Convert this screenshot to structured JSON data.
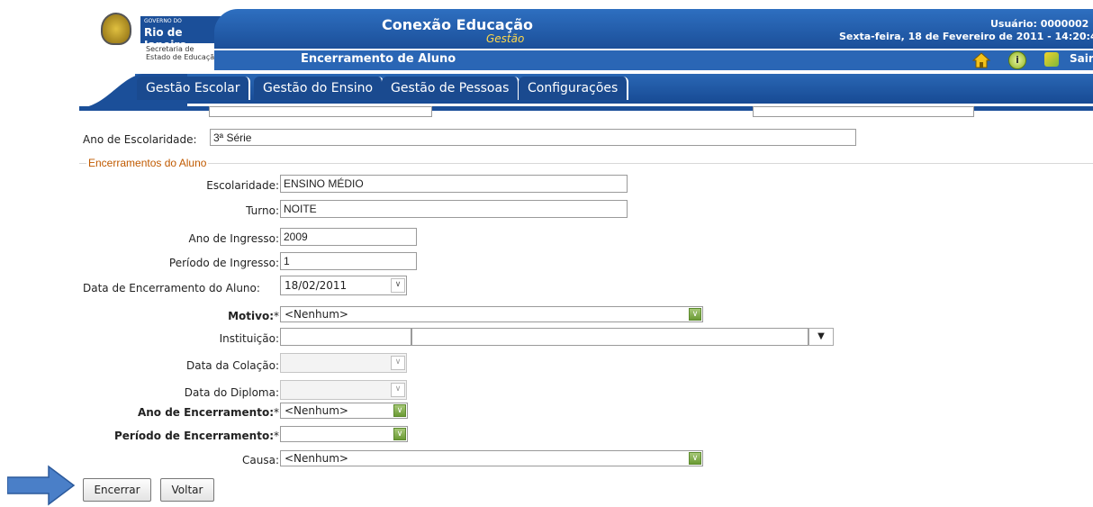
{
  "header": {
    "logo_small": "GOVERNO DO",
    "logo_state": "Rio de Janeiro",
    "logo_dept_line1": "Secretaria de",
    "logo_dept_line2": "Estado de Educação",
    "app_title": "Conexão Educação",
    "app_subtitle": "Gestão",
    "page_title": "Encerramento de Aluno",
    "user_label": "Usuário: 0000002",
    "date_line": "Sexta-feira, 18 de Fevereiro de 2011 - 14:20:4",
    "exit_label": "Sair"
  },
  "nav": {
    "tabs": [
      "Gestão Escolar",
      "Gestão do Ensino",
      "Gestão de Pessoas",
      "Configurações"
    ]
  },
  "form": {
    "ano_escolaridade_label": "Ano de Escolaridade:",
    "ano_escolaridade_value": "3ª Série",
    "fieldset_legend": "Encerramentos do Aluno",
    "escolaridade_label": "Escolaridade:",
    "escolaridade_value": "ENSINO MÉDIO",
    "turno_label": "Turno:",
    "turno_value": "NOITE",
    "ano_ingresso_label": "Ano de Ingresso:",
    "ano_ingresso_value": "2009",
    "periodo_ingresso_label": "Período de Ingresso:",
    "periodo_ingresso_value": "1",
    "data_encerramento_label": "Data de Encerramento do Aluno:",
    "data_encerramento_value": "18/02/2011",
    "motivo_label": "Motivo:",
    "motivo_value": "<Nenhum>",
    "instituicao_label": "Instituição:",
    "data_colacao_label": "Data da Colação:",
    "data_diploma_label": "Data do Diploma:",
    "ano_encerramento_label": "Ano de Encerramento:",
    "ano_encerramento_value": "<Nenhum>",
    "periodo_encerramento_label": "Período de Encerramento:",
    "periodo_encerramento_value": "",
    "causa_label": "Causa:",
    "causa_value": "<Nenhum>",
    "required_mark": "*"
  },
  "buttons": {
    "encerrar": "Encerrar",
    "voltar": "Voltar"
  },
  "colors": {
    "header_blue": "#1b4f99",
    "arrow_blue": "#4a7fc8",
    "legend_orange": "#c05a00"
  }
}
